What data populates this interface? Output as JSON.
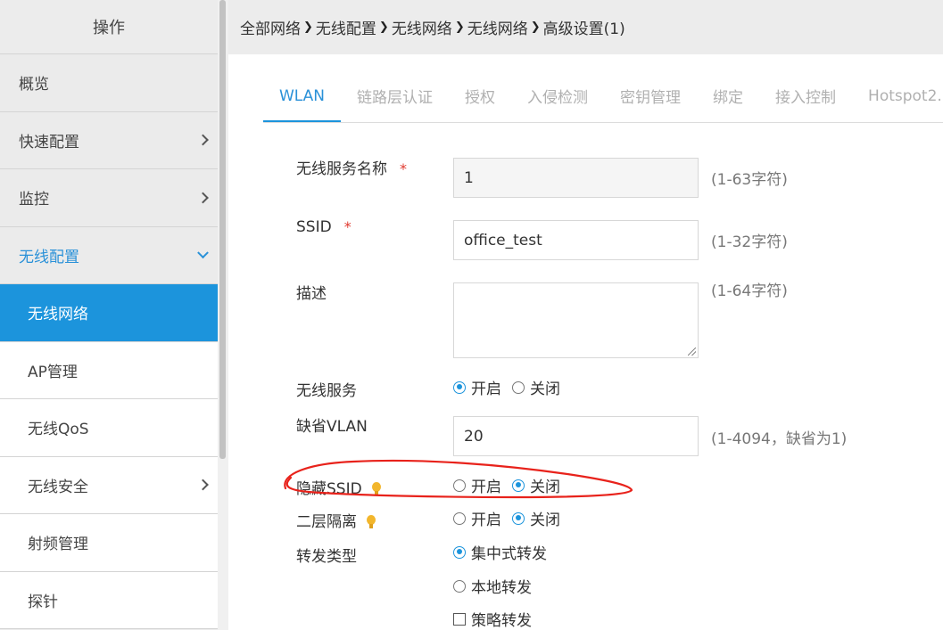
{
  "sidebar": {
    "header": "操作",
    "items": [
      {
        "label": "概览"
      },
      {
        "label": "快速配置"
      },
      {
        "label": "监控"
      },
      {
        "label": "无线配置"
      }
    ],
    "sub_items": [
      {
        "label": "无线网络"
      },
      {
        "label": "AP管理"
      },
      {
        "label": "无线QoS"
      },
      {
        "label": "无线安全"
      },
      {
        "label": "射频管理"
      },
      {
        "label": "探针"
      }
    ]
  },
  "breadcrumb": [
    "全部网络",
    "无线配置",
    "无线网络",
    "无线网络",
    "高级设置(1)"
  ],
  "tabs": [
    "WLAN",
    "链路层认证",
    "授权",
    "入侵检测",
    "密钥管理",
    "绑定",
    "接入控制",
    "Hotspot2."
  ],
  "form": {
    "service_name": {
      "label": "无线服务名称",
      "value": "1",
      "hint": "(1-63字符)",
      "required": "*"
    },
    "ssid": {
      "label": "SSID",
      "value": "office_test",
      "hint": "(1-32字符)",
      "required": "*"
    },
    "description": {
      "label": "描述",
      "value": "",
      "hint": "(1-64字符)"
    },
    "wireless_service": {
      "label": "无线服务",
      "options": [
        "开启",
        "关闭"
      ],
      "selected": "开启"
    },
    "default_vlan": {
      "label": "缺省VLAN",
      "value": "20",
      "hint": "(1-4094，缺省为1)"
    },
    "hide_ssid": {
      "label": "隐藏SSID",
      "options": [
        "开启",
        "关闭"
      ],
      "selected": "关闭"
    },
    "l2_isolation": {
      "label": "二层隔离",
      "options": [
        "开启",
        "关闭"
      ],
      "selected": "关闭"
    },
    "forward_type": {
      "label": "转发类型",
      "options": [
        "集中式转发",
        "本地转发"
      ],
      "selected": "集中式转发",
      "policy_checkbox": "策略转发"
    }
  },
  "colors": {
    "accent": "#1c94dc",
    "annotation": "#e8221b",
    "required": "#e0382e",
    "bulb": "#f2b62c"
  }
}
